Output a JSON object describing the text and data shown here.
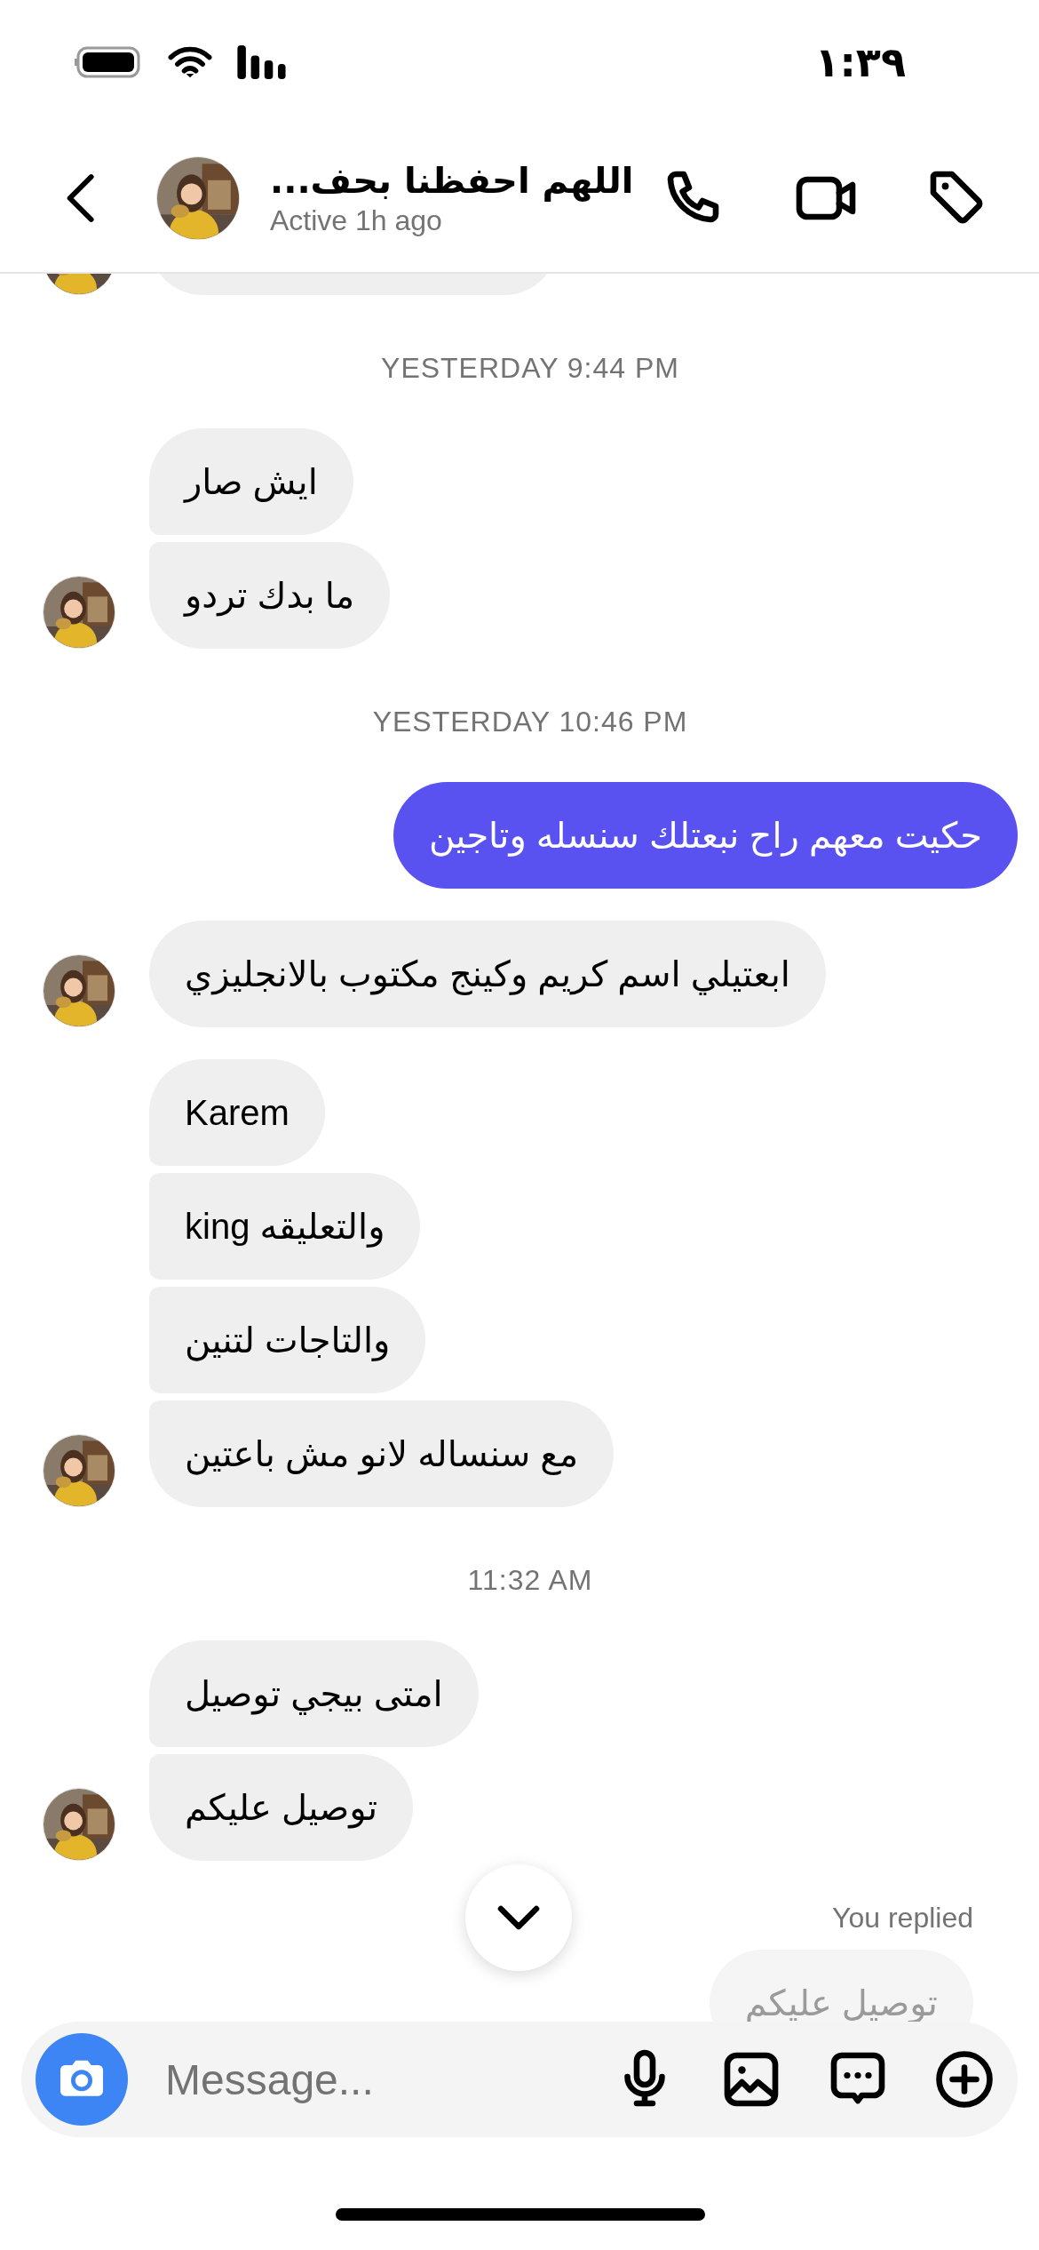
{
  "status_bar": {
    "time": "١:٣٩"
  },
  "header": {
    "name": "اللهم احفظنا بحف...",
    "status": "Active 1h ago"
  },
  "messages": [
    {
      "kind": "clipped"
    },
    {
      "kind": "timestamp",
      "text": "YESTERDAY 9:44 PM"
    },
    {
      "kind": "group",
      "outgoing": false,
      "texts": [
        "ايش صار",
        "ما بدك تردو"
      ]
    },
    {
      "kind": "timestamp",
      "text": "YESTERDAY 10:46 PM"
    },
    {
      "kind": "group",
      "outgoing": true,
      "texts": [
        "حكيت معهم راح نبعتلك سنسله وتاجين"
      ]
    },
    {
      "kind": "group",
      "outgoing": false,
      "texts": [
        "ابعتيلي اسم كريم وكينج مكتوب بالانجليزي"
      ]
    },
    {
      "kind": "group",
      "outgoing": false,
      "texts": [
        "Karem",
        "والتعليقه king",
        "والتاجات لتنين",
        "مع سنساله لانو مش باعتين"
      ]
    },
    {
      "kind": "timestamp",
      "text": "11:32 AM"
    },
    {
      "kind": "group",
      "outgoing": false,
      "texts": [
        "امتى بيجي توصيل",
        "توصيل عليكم"
      ]
    },
    {
      "kind": "reply",
      "label": "You replied",
      "text": "توصيل عليكم"
    }
  ],
  "composer": {
    "placeholder": "Message..."
  }
}
